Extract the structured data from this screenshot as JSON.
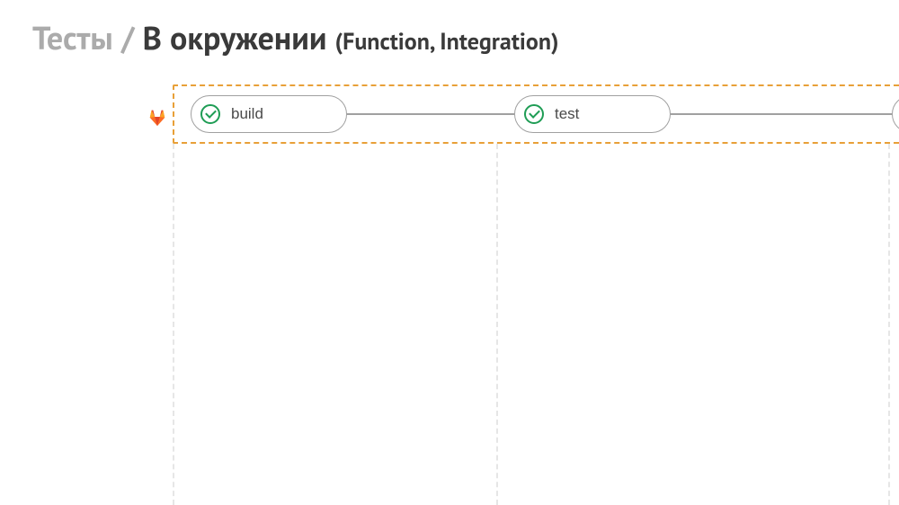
{
  "heading": {
    "breadcrumb": "Тесты / ",
    "main": "В окружении ",
    "subtitle": "(Function, Integration)"
  },
  "pipeline": {
    "stages": [
      {
        "label": "build",
        "status": "success"
      },
      {
        "label": "test",
        "status": "success"
      }
    ]
  },
  "icons": {
    "gitlab": "gitlab-icon",
    "status_success": "check-icon"
  },
  "colors": {
    "accent_dashed": "#e8a038",
    "node_border": "#a0a0a0",
    "success": "#1f9d55",
    "text_muted": "#ababab",
    "text_primary": "#3a3a3a"
  }
}
